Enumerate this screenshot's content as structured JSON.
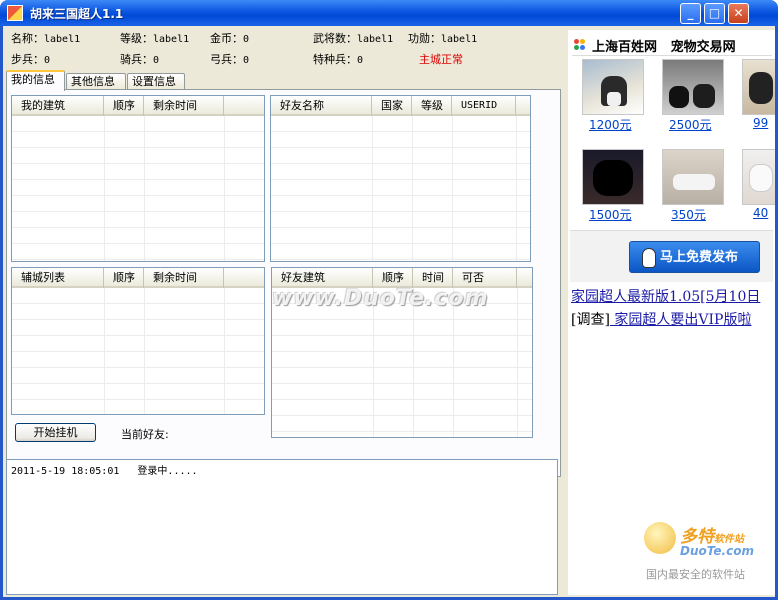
{
  "window": {
    "title": "胡来三国超人1.1"
  },
  "stats": {
    "name_label": "名称：",
    "name_value": "label1",
    "level_label": "等级：",
    "level_value": "label1",
    "gold_label": "金币：",
    "gold_value": "0",
    "generals_label": "武将数：",
    "generals_value": "label1",
    "merit_label": "功勋：",
    "merit_value": "label1",
    "infantry_label": "步兵：",
    "infantry_value": "0",
    "cavalry_label": "骑兵：",
    "cavalry_value": "0",
    "archer_label": "弓兵：",
    "archer_value": "0",
    "special_label": "特种兵：",
    "special_value": "0",
    "city_status": "主城正常"
  },
  "tabs": [
    {
      "label": "我的信息",
      "active": true
    },
    {
      "label": "其他信息",
      "active": false
    },
    {
      "label": "设置信息",
      "active": false
    }
  ],
  "grids": {
    "my_buildings": [
      "我的建筑",
      "顺序",
      "剩余时间",
      ""
    ],
    "friends": [
      "好友名称",
      "国家",
      "等级",
      "USERID",
      ""
    ],
    "aux_cities": [
      "辅城列表",
      "顺序",
      "剩余时间",
      ""
    ],
    "friend_buildings": [
      "好友建筑",
      "顺序",
      "时间",
      "可否",
      ""
    ]
  },
  "controls": {
    "start_button": "开始挂机",
    "current_friend_label": "当前好友:"
  },
  "log": {
    "lines": [
      "2011-5-19 18:05:01   登录中....."
    ]
  },
  "ad": {
    "site": "上海百姓网",
    "category": "宠物交易网",
    "prices": [
      "1200元",
      "2500元",
      "99",
      "1500元",
      "350元",
      "40"
    ],
    "post_button": "马上免费发布",
    "news": [
      {
        "text": "家园超人最新版1.05[5月10日"
      },
      {
        "prefix": "[调查]",
        "text": " 家园超人要出VIP版啦"
      }
    ]
  },
  "watermarks": {
    "center": "www.DuoTe.com",
    "brand": "多特",
    "brand_suffix": "软件站",
    "url": "DuoTe.com",
    "slogan": "国内最安全的软件站"
  },
  "colors": {
    "titlebar": "#0a55e0",
    "status_red": "#e00000",
    "link_blue": "#0044cc",
    "post_button": "#1a6fe0"
  }
}
